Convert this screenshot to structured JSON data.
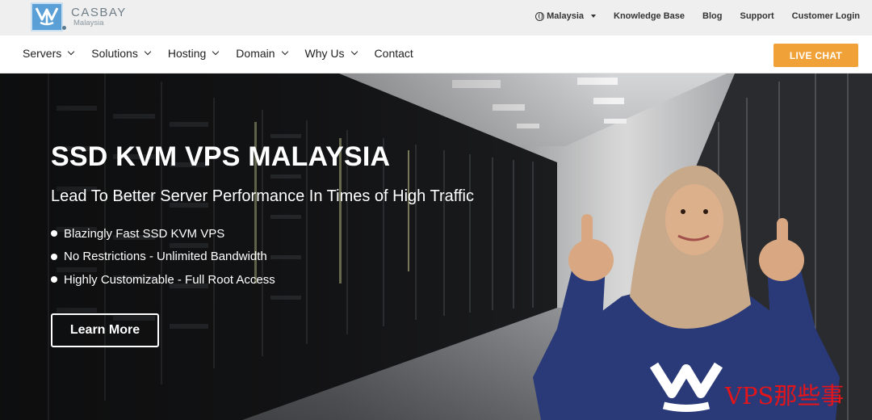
{
  "brand": {
    "name": "CASBAY",
    "sub": "Malaysia",
    "color": "#5aa0d6",
    "logo_icon": "casbay-logo-icon"
  },
  "topbar": {
    "country": "Malaysia",
    "country_icon": "globe-icon",
    "links": [
      "Knowledge Base",
      "Blog",
      "Support",
      "Customer Login"
    ]
  },
  "nav": {
    "items": [
      {
        "label": "Servers",
        "dropdown": true
      },
      {
        "label": "Solutions",
        "dropdown": true
      },
      {
        "label": "Hosting",
        "dropdown": true
      },
      {
        "label": "Domain",
        "dropdown": true
      },
      {
        "label": "Why Us",
        "dropdown": true
      },
      {
        "label": "Contact",
        "dropdown": false
      }
    ],
    "live_chat": "LIVE CHAT",
    "accent": "#f0a239"
  },
  "hero": {
    "title": "SSD KVM VPS MALAYSIA",
    "subtitle": "Lead To Better Server Performance In Times of High Traffic",
    "bullets": [
      "Blazingly Fast SSD KVM VPS",
      "No Restrictions - Unlimited Bandwidth",
      "Highly Customizable - Full Root Access"
    ],
    "cta": "Learn More",
    "shirt_color": "#2a3a78",
    "hijab_color": "#c8a98a"
  },
  "watermark": "VPS那些事"
}
